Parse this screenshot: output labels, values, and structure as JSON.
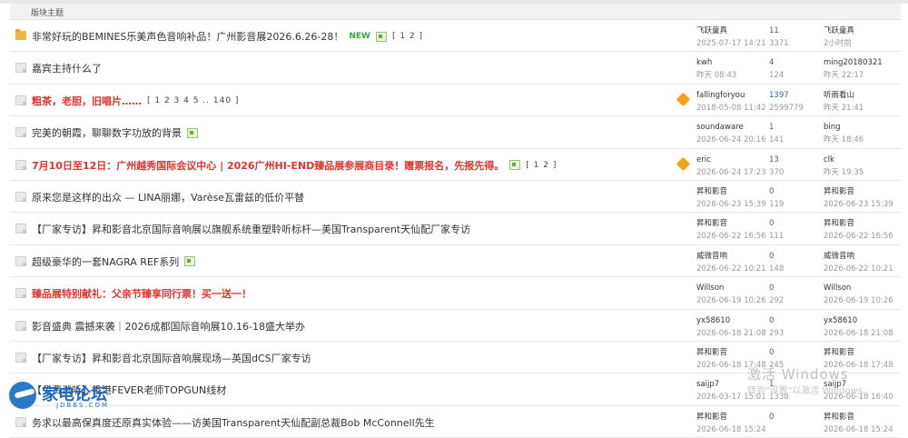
{
  "section": {
    "header": "版块主题"
  },
  "threads": [
    {
      "icon": "folder-icon",
      "title": "非常好玩的BEMINES乐美声色音响补品！广州影音展2026.6.26-28！",
      "red": false,
      "new_tag": "NEW",
      "attach": true,
      "pages": "[ 1 2 ]",
      "digest": false,
      "author": "飞跃童真",
      "post_time": "2025-07-17 14:21",
      "replies": "11",
      "views": "3371",
      "last_user": "飞跃童真",
      "last_time": "2小时前"
    },
    {
      "icon": "doc-icon",
      "title": "嘉宾主持什么了",
      "red": false,
      "new_tag": "",
      "attach": false,
      "pages": "",
      "digest": false,
      "author": "kwh",
      "post_time": "昨天 08:43",
      "replies": "4",
      "views": "124",
      "last_user": "ming20180321",
      "last_time": "昨天 22:17"
    },
    {
      "icon": "doc-icon",
      "title": "粗茶，老胆，旧唱片……",
      "red": true,
      "new_tag": "",
      "attach": false,
      "pages": "[ 1 2 3 4 5 .. 140 ]",
      "digest": true,
      "author": "fallingforyou",
      "post_time": "2018-05-08 11:42",
      "replies": "1397",
      "views": "2599779",
      "last_user": "听雨看山",
      "last_time": "昨天 21:41"
    },
    {
      "icon": "doc-icon",
      "title": "完美的朝霞，聊聊数字功放的背景",
      "red": false,
      "new_tag": "",
      "attach": true,
      "pages": "",
      "digest": false,
      "author": "soundaware",
      "post_time": "2026-06-24 20:16",
      "replies": "1",
      "views": "141",
      "last_user": "bing",
      "last_time": "昨天 18:46"
    },
    {
      "icon": "doc-icon",
      "title": "7月10日至12日：广州越秀国际会议中心 | 2026广州HI-END臻品展参展商目录！赠票报名，先报先得。",
      "red": true,
      "new_tag": "",
      "attach": true,
      "pages": "[ 1 2 ]",
      "digest": true,
      "author": "eric",
      "post_time": "2026-06-24 17:23",
      "replies": "13",
      "views": "370",
      "last_user": "clk",
      "last_time": "昨天 19:35"
    },
    {
      "icon": "doc-icon",
      "title": "原来您是这样的出众 — LINA丽娜，Varèse瓦雷兹的低价平替",
      "red": false,
      "new_tag": "",
      "attach": false,
      "pages": "",
      "digest": false,
      "author": "昇和影音",
      "post_time": "2026-06-23 15:39",
      "replies": "0",
      "views": "119",
      "last_user": "昇和影音",
      "last_time": "2026-06-23 15:39"
    },
    {
      "icon": "doc-icon",
      "title": "【厂家专访】昇和影音北京国际音响展以旗舰系统重塑聆听标杆—美国Transparent天仙配厂家专访",
      "red": false,
      "new_tag": "",
      "attach": false,
      "pages": "",
      "digest": false,
      "author": "昇和影音",
      "post_time": "2026-06-22 16:56",
      "replies": "0",
      "views": "111",
      "last_user": "昇和影音",
      "last_time": "2026-06-22 16:56"
    },
    {
      "icon": "doc-icon",
      "title": "超级豪华的一套NAGRA REF系列",
      "red": false,
      "new_tag": "",
      "attach": true,
      "pages": "",
      "digest": false,
      "author": "威微音响",
      "post_time": "2026-06-22 10:21",
      "replies": "0",
      "views": "148",
      "last_user": "威微音响",
      "last_time": "2026-06-22 10:21"
    },
    {
      "icon": "doc-icon",
      "title": "臻品展特别献礼：父亲节臻享同行票！买一送一！",
      "red": true,
      "new_tag": "",
      "attach": false,
      "pages": "",
      "digest": false,
      "author": "Willson",
      "post_time": "2026-06-19 10:26",
      "replies": "0",
      "views": "292",
      "last_user": "Willson",
      "last_time": "2026-06-19 10:26"
    },
    {
      "icon": "doc-icon",
      "title": "影音盛典 震撼来袭｜2026成都国际音响展10.16-18盛大举办",
      "red": false,
      "new_tag": "",
      "attach": false,
      "pages": "",
      "digest": false,
      "author": "yx58610",
      "post_time": "2026-06-18 21:08",
      "replies": "0",
      "views": "293",
      "last_user": "yx58610",
      "last_time": "2026-06-18 21:08"
    },
    {
      "icon": "doc-icon",
      "title": "【厂家专访】昇和影音北京国际音响展现场—英国dCS厂家专访",
      "red": false,
      "new_tag": "",
      "attach": false,
      "pages": "",
      "digest": false,
      "author": "昇和影音",
      "post_time": "2026-06-18 17:48",
      "replies": "0",
      "views": "245",
      "last_user": "昇和影音",
      "last_time": "2026-06-18 17:48"
    },
    {
      "icon": "doc-icon",
      "title": "【免费试听】香港FEVER老师TOPGUN线材",
      "red": false,
      "new_tag": "",
      "attach": false,
      "pages": "",
      "digest": false,
      "author": "saijp7",
      "post_time": "2026-03-17 15:01",
      "replies": "1",
      "views": "1338",
      "last_user": "saijp7",
      "last_time": "2026-06-18 16:40"
    },
    {
      "icon": "doc-icon",
      "title": "务求以最高保真度还原真实体验——访美国Transparent天仙配副总裁Bob McConnell先生",
      "red": false,
      "new_tag": "",
      "attach": false,
      "pages": "",
      "digest": false,
      "author": "昇和影音",
      "post_time": "2026-06-18 15:24",
      "replies": "0",
      "views": "",
      "last_user": "昇和影音",
      "last_time": "2026-06-18 15:24"
    }
  ],
  "watermark": {
    "line1": "激活 Windows",
    "line2": "转到\"设置\"以激活 Windows。"
  },
  "logo": {
    "name": "家电论坛",
    "domain": "JDBBS.COM"
  }
}
